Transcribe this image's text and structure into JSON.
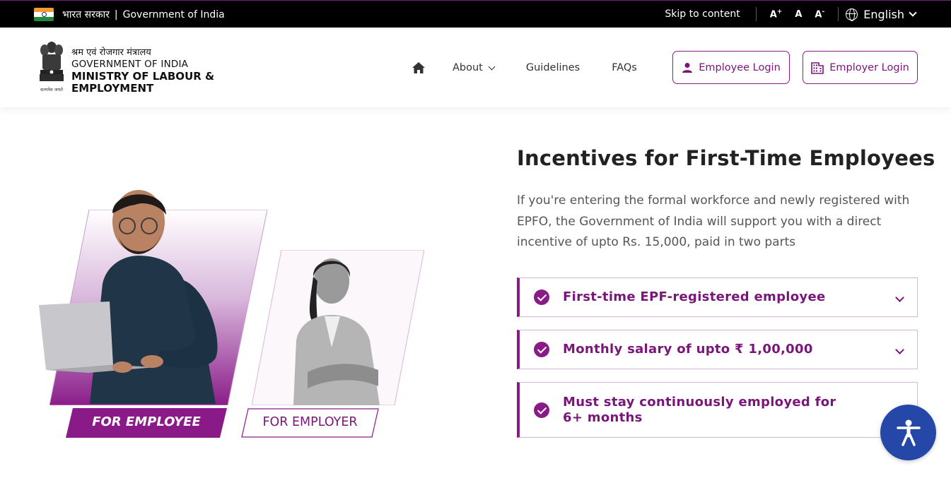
{
  "topbar": {
    "gov_hindi": "भारत सरकार",
    "separator": "|",
    "gov_english": "Government of India",
    "skip": "Skip to content",
    "font_increase": "A",
    "font_normal": "A",
    "font_decrease": "A",
    "language": "English"
  },
  "header": {
    "ministry_hindi": "श्रम एवं रोजगार मंत्रालय",
    "ministry_goi": "GOVERNMENT OF INDIA",
    "ministry_line1": "MINISTRY OF LABOUR &",
    "ministry_line2": "EMPLOYMENT",
    "emblem_motto": "सत्यमेव जयते",
    "nav": {
      "about": "About",
      "guidelines": "Guidelines",
      "faqs": "FAQs"
    },
    "employee_login": "Employee Login",
    "employer_login": "Employer Login"
  },
  "hero": {
    "tab_employee": "FOR EMPLOYEE",
    "tab_employer": "FOR EMPLOYER",
    "title": "Incentives for First-Time Employees",
    "description": "If you're entering the formal workforce and newly registered with EPFO, the Government of India will support you with a direct incentive of upto Rs. 15,000, paid in two parts",
    "criteria": [
      {
        "label": "First-time EPF-registered employee"
      },
      {
        "label": "Monthly salary of upto ₹ 1,00,000"
      },
      {
        "label": "Must stay continuously employed for 6+ months"
      }
    ]
  },
  "colors": {
    "brand_purple": "#8a1a87",
    "topbar_bg": "#000000",
    "accessibility_blue": "#2447a8"
  },
  "icons": {
    "home": "home-icon",
    "user": "user-icon",
    "building": "building-icon",
    "globe": "globe-icon",
    "check": "check-circle-icon",
    "accessibility": "accessibility-icon"
  }
}
